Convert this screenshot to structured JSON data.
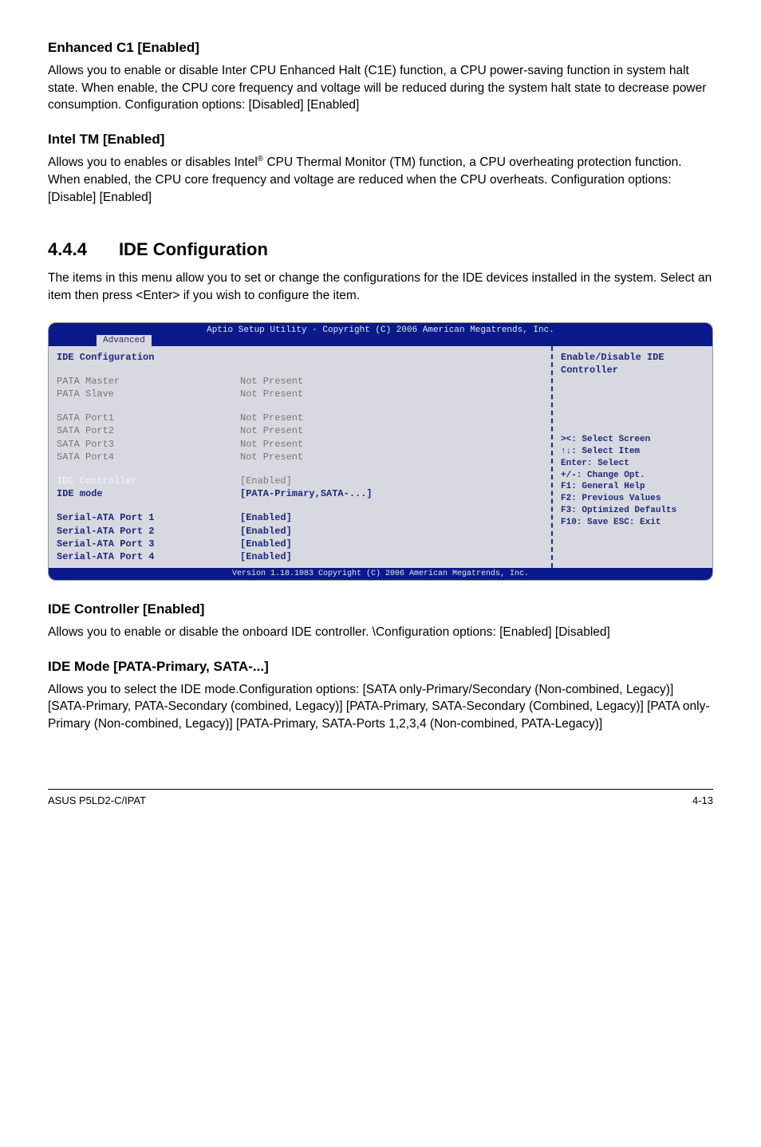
{
  "sections": {
    "enhancedC1": {
      "heading": "Enhanced C1 [Enabled]",
      "text": "Allows you to enable or disable Inter CPU Enhanced Halt (C1E) function, a CPU power-saving function in system halt state. When enable, the CPU core frequency and voltage will be reduced during the system halt state to decrease power consumption. Configuration options: [Disabled] [Enabled]"
    },
    "intelTM": {
      "heading": "Intel TM [Enabled]",
      "textPrefix": "Allows you to enables or disables Intel",
      "textSuffix": " CPU Thermal Monitor (TM) function, a CPU overheating  protection function. When enabled, the CPU core frequency and voltage are reduced when the CPU overheats. Configuration options: [Disable] [Enabled]"
    },
    "ideConfig": {
      "number": "4.4.4",
      "title": "IDE Configuration",
      "intro": "The items in this menu allow you to set or change the configurations for the IDE devices installed in the system. Select an item then press <Enter> if you wish to configure the item."
    },
    "ideController": {
      "heading": "IDE Controller [Enabled]",
      "text": "Allows you to enable or disable the onboard IDE controller. \\Configuration options: [Enabled] [Disabled]"
    },
    "ideMode": {
      "heading": "IDE Mode [PATA-Primary, SATA-...]",
      "text": "Allows you to select the IDE mode.Configuration options: [SATA only-Primary/Secondary (Non-combined, Legacy)] [SATA-Primary, PATA-Secondary (combined, Legacy)] [PATA-Primary, SATA-Secondary (Combined, Legacy)] [PATA only-Primary (Non-combined, Legacy)] [PATA-Primary, SATA-Ports 1,2,3,4 (Non-combined, PATA-Legacy)]"
    }
  },
  "bios": {
    "headerTitle": "Aptio Setup Utility - Copyright (C) 2006 American Megatrends, Inc.",
    "tab": "Advanced",
    "configTitle": "IDE Configuration",
    "rows": {
      "pataMaster": {
        "label": "PATA Master",
        "value": "Not Present"
      },
      "pataSlave": {
        "label": "PATA Slave",
        "value": "Not Present"
      },
      "sata1": {
        "label": "SATA Port1",
        "value": "Not Present"
      },
      "sata2": {
        "label": "SATA Port2",
        "value": "Not Present"
      },
      "sata3": {
        "label": "SATA Port3",
        "value": "Not Present"
      },
      "sata4": {
        "label": "SATA Port4",
        "value": "Not Present"
      },
      "ideCtrl": {
        "label": "IDE Controller",
        "value": "[Enabled]"
      },
      "ideMode": {
        "label": "IDE mode",
        "value": "[PATA-Primary,SATA-...]"
      },
      "serial1": {
        "label": "Serial-ATA Port 1",
        "value": "[Enabled]"
      },
      "serial2": {
        "label": "Serial-ATA Port 2",
        "value": "[Enabled]"
      },
      "serial3": {
        "label": "Serial-ATA Port 3",
        "value": "[Enabled]"
      },
      "serial4": {
        "label": "Serial-ATA Port 4",
        "value": "[Enabled]"
      }
    },
    "rightTop1": "Enable/Disable IDE",
    "rightTop2": "Controller",
    "help": {
      "l1": "><: Select Screen",
      "l2": "↑↓: Select Item",
      "l3": "Enter: Select",
      "l4": "+/-: Change Opt.",
      "l5": "F1: General Help",
      "l6": "F2: Previous Values",
      "l7": "F3: Optimized Defaults",
      "l8": "F10: Save  ESC: Exit"
    },
    "footer": "Version 1.18.1083 Copyright (C) 2006 American Megatrends, Inc."
  },
  "footer": {
    "left": "ASUS P5LD2-C/IPAT",
    "right": "4-13"
  }
}
